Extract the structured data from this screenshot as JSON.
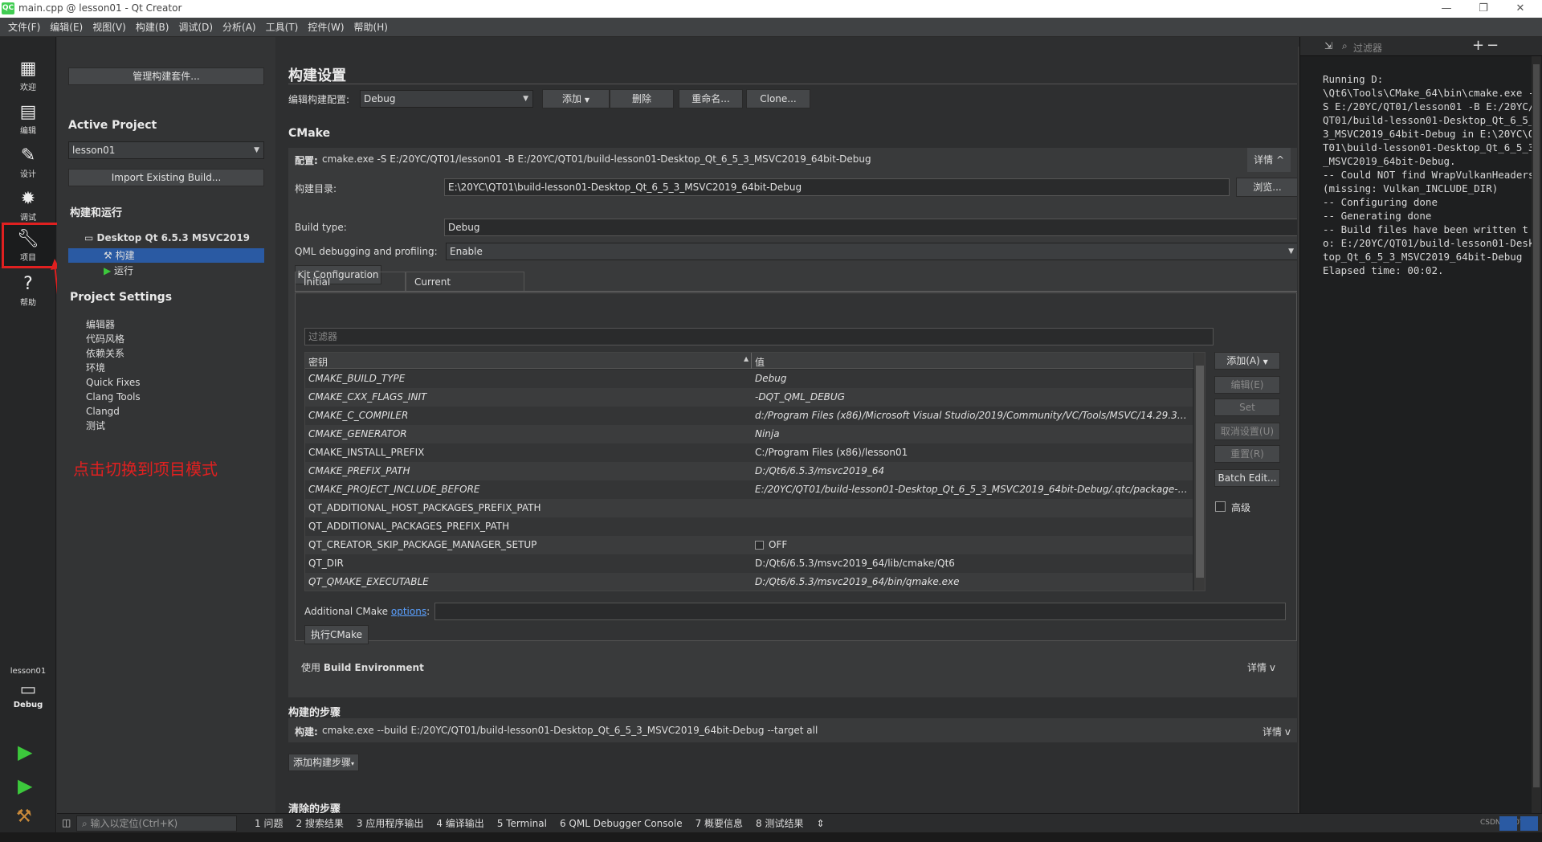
{
  "window": {
    "title": "main.cpp @ lesson01 - Qt Creator",
    "logo": "QC",
    "minimize": "—",
    "maximize": "❐",
    "close": "✕"
  },
  "menu": [
    "文件(F)",
    "编辑(E)",
    "视图(V)",
    "构建(B)",
    "调试(D)",
    "分析(A)",
    "工具(T)",
    "控件(W)",
    "帮助(H)"
  ],
  "modes": [
    {
      "label": "欢迎",
      "icon": "grid-icon"
    },
    {
      "label": "编辑",
      "icon": "document-icon"
    },
    {
      "label": "设计",
      "icon": "pencil-icon"
    },
    {
      "label": "调试",
      "icon": "bug-icon"
    },
    {
      "label": "项目",
      "icon": "wrench-icon"
    },
    {
      "label": "帮助",
      "icon": "help-icon"
    }
  ],
  "kit_selector": {
    "project": "lesson01",
    "config": "Debug"
  },
  "annotation": {
    "text": "点击切换到项目模式",
    "color": "#e02020"
  },
  "nav": {
    "manage_kits": "管理构建套件...",
    "active_project_title": "Active Project",
    "active_project": "lesson01",
    "import_build": "Import Existing Build...",
    "build_run_title": "构建和运行",
    "kit_name": "Desktop Qt 6.5.3 MSVC2019 6...",
    "build_item": "构建",
    "run_item": "运行",
    "project_settings_title": "Project Settings",
    "settings_items": [
      "编辑器",
      "代码风格",
      "依赖关系",
      "环境",
      "Quick Fixes",
      "Clang Tools",
      "Clangd",
      "测试"
    ]
  },
  "content": {
    "title": "构建设置",
    "edit_config_label": "编辑构建配置:",
    "edit_config_value": "Debug",
    "add_btn": "添加",
    "delete_btn": "删除",
    "rename_btn": "重命名...",
    "clone_btn": "Clone...",
    "cmake_title": "CMake",
    "configure_prefix": "配置:",
    "configure_cmd": "cmake.exe -S E:/20YC/QT01/lesson01 -B E:/20YC/QT01/build-lesson01-Desktop_Qt_6_5_3_MSVC2019_64bit-Debug",
    "details": "详情",
    "build_dir_label": "构建目录:",
    "build_dir_value": "E:\\20YC\\QT01\\build-lesson01-Desktop_Qt_6_5_3_MSVC2019_64bit-Debug",
    "browse_btn": "浏览...",
    "build_type_label": "Build type:",
    "build_type_value": "Debug",
    "qml_label": "QML debugging and profiling:",
    "qml_value": "Enable",
    "kit_config_btn": "Kit Configuration",
    "tab_initial": "Initial Configuration",
    "tab_current": "Current Configuration",
    "filter_placeholder": "过滤器",
    "col_key": "密钥",
    "col_value": "值",
    "rows": [
      {
        "key": "CMAKE_BUILD_TYPE",
        "value": "Debug",
        "italic": true
      },
      {
        "key": "CMAKE_CXX_FLAGS_INIT",
        "value": "-DQT_QML_DEBUG",
        "italic": true
      },
      {
        "key": "CMAKE_C_COMPILER",
        "value": "d:/Program Files (x86)/Microsoft Visual Studio/2019/Community/VC/Tools/MSVC/14.29.3013...",
        "italic": true
      },
      {
        "key": "CMAKE_GENERATOR",
        "value": "Ninja",
        "italic": true
      },
      {
        "key": "CMAKE_INSTALL_PREFIX",
        "value": "C:/Program Files (x86)/lesson01",
        "italic": false
      },
      {
        "key": "CMAKE_PREFIX_PATH",
        "value": "D:/Qt6/6.5.3/msvc2019_64",
        "italic": true
      },
      {
        "key": "CMAKE_PROJECT_INCLUDE_BEFORE",
        "value": "E:/20YC/QT01/build-lesson01-Desktop_Qt_6_5_3_MSVC2019_64bit-Debug/.qtc/package-man...",
        "italic": true
      },
      {
        "key": "QT_ADDITIONAL_HOST_PACKAGES_PREFIX_PATH",
        "value": "",
        "italic": false
      },
      {
        "key": "QT_ADDITIONAL_PACKAGES_PREFIX_PATH",
        "value": "",
        "italic": false
      },
      {
        "key": "QT_CREATOR_SKIP_PACKAGE_MANAGER_SETUP",
        "value": "OFF",
        "italic": false,
        "checkbox": true
      },
      {
        "key": "QT_DIR",
        "value": "D:/Qt6/6.5.3/msvc2019_64/lib/cmake/Qt6",
        "italic": false
      },
      {
        "key": "QT_QMAKE_EXECUTABLE",
        "value": "D:/Qt6/6.5.3/msvc2019_64/bin/qmake.exe",
        "italic": true
      }
    ],
    "side_add": "添加(A)",
    "side_edit": "编辑(E)",
    "side_set": "Set",
    "side_unset": "取消设置(U)",
    "side_reset": "重置(R)",
    "side_batch": "Batch Edit...",
    "advanced": "高级",
    "additional_label": "Additional CMake",
    "options_link": "options",
    "run_cmake": "执行CMake",
    "env_prefix": "使用",
    "env_name": "Build Environment",
    "build_steps_title": "构建的步骤",
    "build_prefix": "构建:",
    "build_cmd": "cmake.exe --build E:/20YC/QT01/build-lesson01-Desktop_Qt_6_5_3_MSVC2019_64bit-Debug --target all",
    "add_build_step": "添加构建步骤",
    "clean_steps_title": "清除的步骤"
  },
  "output": {
    "filter_placeholder": "过滤器",
    "plus": "+",
    "minus": "−",
    "text": "Running D:\n\\Qt6\\Tools\\CMake_64\\bin\\cmake.exe -S E:/20YC/QT01/lesson01 -B E:/20YC/QT01/build-lesson01-Desktop_Qt_6_5_3_MSVC2019_64bit-Debug in E:\\20YC\\QT01\\build-lesson01-Desktop_Qt_6_5_3_MSVC2019_64bit-Debug.\n-- Could NOT find WrapVulkanHeaders (missing: Vulkan_INCLUDE_DIR)\n-- Configuring done\n-- Generating done\n-- Build files have been written to: E:/20YC/QT01/build-lesson01-Desktop_Qt_6_5_3_MSVC2019_64bit-Debug\nElapsed time: 00:02."
  },
  "statusbar": {
    "locator_placeholder": "输入以定位(Ctrl+K)",
    "tabs": [
      "1 问题",
      "2 搜索结果",
      "3 应用程序输出",
      "4 编译输出",
      "5 Terminal",
      "6 QML Debugger Console",
      "7 概要信息",
      "8 测试结果"
    ],
    "watermark": "CSDN @20YC"
  },
  "colors": {
    "accent": "#2a5aa3",
    "annotation": "#e02020",
    "run_green": "#3cc83c",
    "link": "#5aa0ff"
  }
}
